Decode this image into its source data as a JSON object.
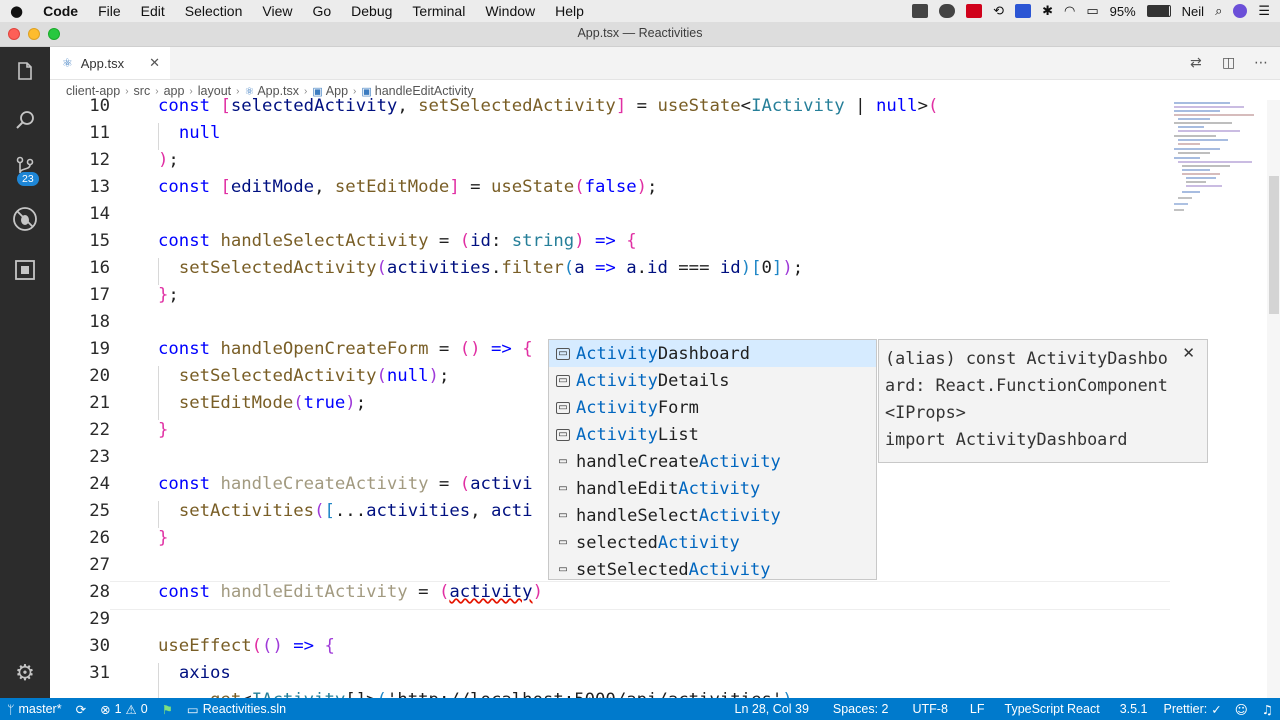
{
  "menubar": {
    "app": "Code",
    "items": [
      "File",
      "Edit",
      "Selection",
      "View",
      "Go",
      "Debug",
      "Terminal",
      "Window",
      "Help"
    ],
    "battery": "95%",
    "user": "Neil"
  },
  "window": {
    "title": "App.tsx — Reactivities"
  },
  "activity_bar": {
    "scm_badge": "23"
  },
  "tab": {
    "icon": "TS",
    "label": "App.tsx"
  },
  "breadcrumb": [
    "client-app",
    "src",
    "app",
    "layout",
    "App.tsx",
    "App",
    "handleEditActivity"
  ],
  "editor": {
    "line_numbers": [
      "10",
      "11",
      "12",
      "13",
      "14",
      "15",
      "16",
      "17",
      "18",
      "19",
      "20",
      "21",
      "22",
      "23",
      "24",
      "25",
      "26",
      "27",
      "28",
      "29",
      "30",
      "31"
    ]
  },
  "suggestions": [
    {
      "kind": "module",
      "match": "Activity",
      "rest": "Dashboard",
      "prefix": ""
    },
    {
      "kind": "module",
      "match": "Activity",
      "rest": "Details",
      "prefix": ""
    },
    {
      "kind": "module",
      "match": "Activity",
      "rest": "Form",
      "prefix": ""
    },
    {
      "kind": "module",
      "match": "Activity",
      "rest": "List",
      "prefix": ""
    },
    {
      "kind": "variable",
      "match": "Activity",
      "rest": "",
      "prefix": "handleCreate"
    },
    {
      "kind": "variable",
      "match": "Activity",
      "rest": "",
      "prefix": "handleEdit"
    },
    {
      "kind": "variable",
      "match": "Activity",
      "rest": "",
      "prefix": "handleSelect"
    },
    {
      "kind": "variable",
      "match": "Activity",
      "rest": "",
      "prefix": "selected"
    },
    {
      "kind": "variable",
      "match": "Activity",
      "rest": "",
      "prefix": "setSelected"
    }
  ],
  "details": {
    "text": "(alias) const ActivityDashboard: React.FunctionComponent<IProps>\nimport ActivityDashboard"
  },
  "statusbar": {
    "branch": "master*",
    "errors": "1",
    "warnings": "0",
    "solution": "Reactivities.sln",
    "position": "Ln 28, Col 39",
    "spaces": "Spaces: 2",
    "encoding": "UTF-8",
    "eol": "LF",
    "language": "TypeScript React",
    "version": "3.5.1",
    "prettier": "Prettier:"
  },
  "colors": {
    "activity_bar": "#2c2c2c",
    "status_bar": "#007acc",
    "keyword": "#0000ff",
    "function": "#795e26",
    "type": "#267f99",
    "match_highlight": "#0066bf"
  }
}
